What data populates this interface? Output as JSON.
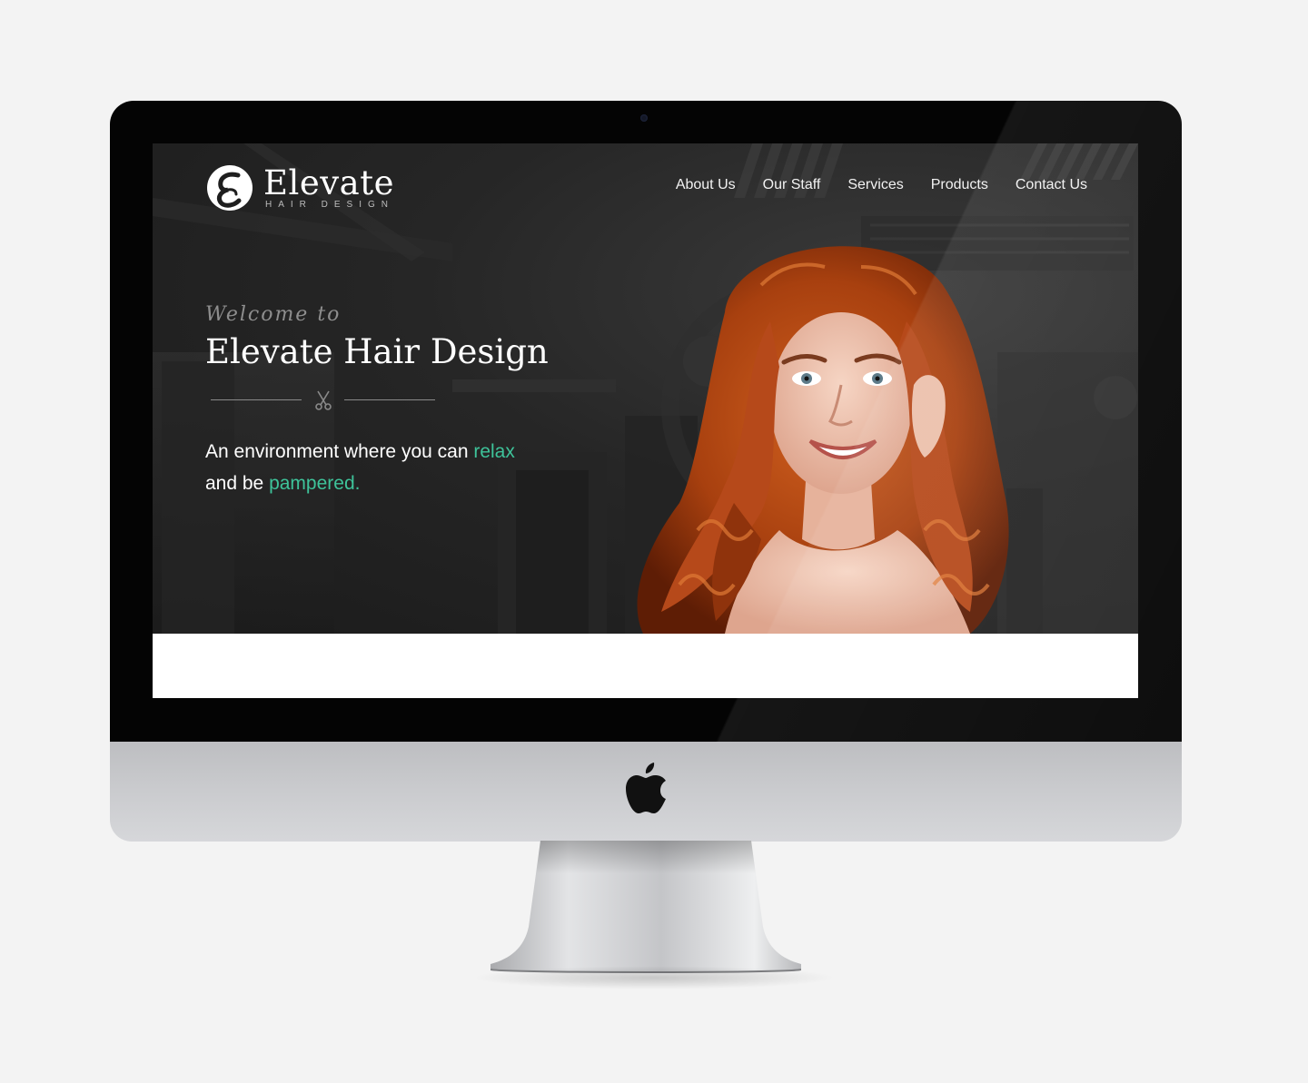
{
  "site": {
    "brand_name": "Elevate",
    "brand_tagline": "HAIR DESIGN",
    "nav": [
      {
        "label": "About Us"
      },
      {
        "label": "Our Staff"
      },
      {
        "label": "Services"
      },
      {
        "label": "Products"
      },
      {
        "label": "Contact Us"
      }
    ],
    "hero": {
      "welcome": "Welcome to",
      "headline": "Elevate Hair Design",
      "tagline_part1": "An environment where you can ",
      "tagline_accent1": "relax",
      "tagline_part2": " and be ",
      "tagline_accent2": "pampered."
    }
  },
  "colors": {
    "accent": "#3ec39a",
    "hero_bg": "#222222",
    "hair": "#b44518"
  },
  "icons": [
    "logo-mark-icon",
    "scissors-icon",
    "apple-logo-icon"
  ]
}
